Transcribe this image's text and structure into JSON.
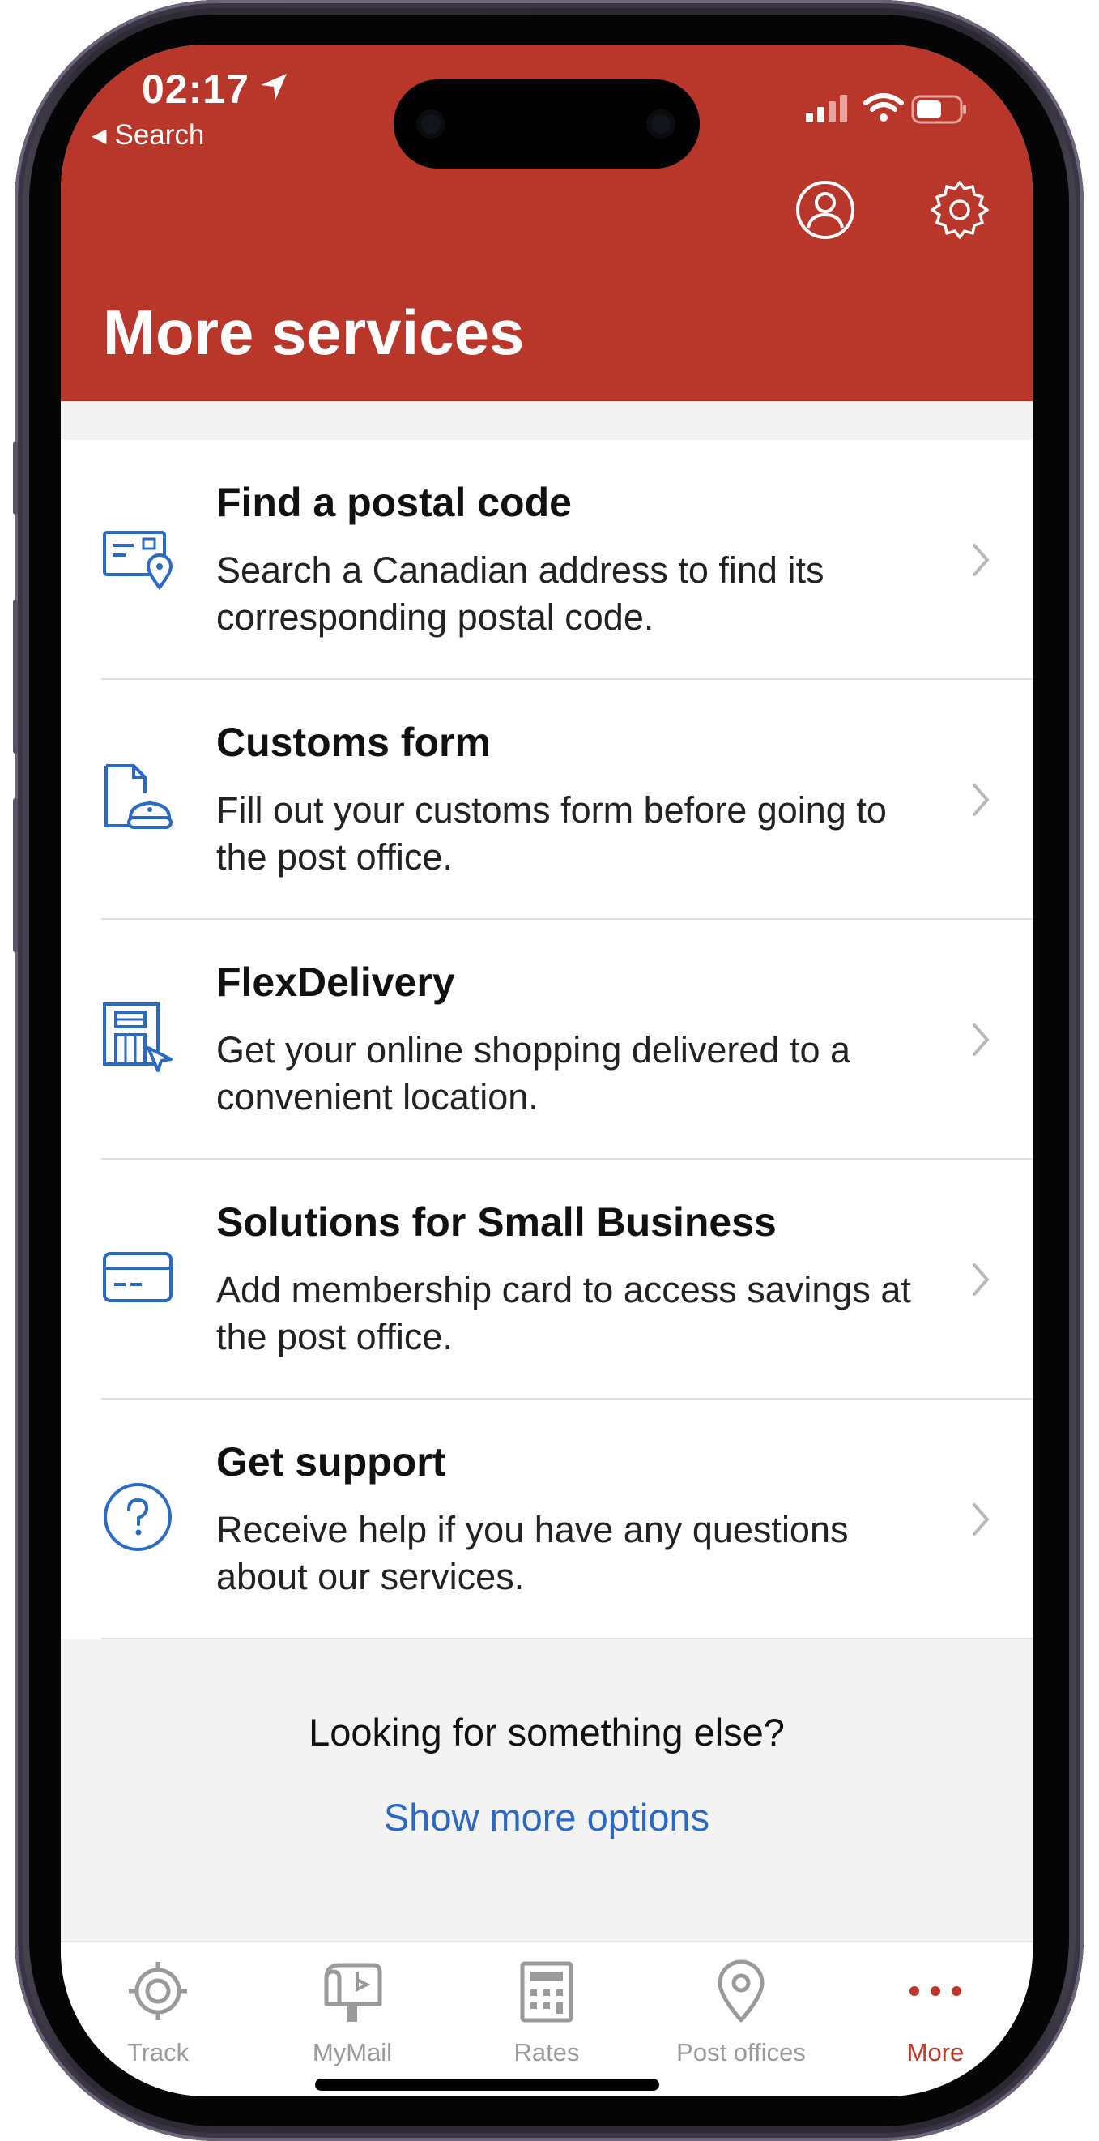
{
  "status_bar": {
    "time": "02:17",
    "back_label": "Search"
  },
  "header": {
    "title": "More services",
    "background_color": "#b8362a",
    "icons": [
      "profile-icon",
      "settings-gear-icon"
    ]
  },
  "services": [
    {
      "title": "Find a postal code",
      "description": "Search a Canadian address to find its corresponding postal code.",
      "icon": "postal-code-map-pin-icon"
    },
    {
      "title": "Customs form",
      "description": "Fill out your customs form before going to the post office.",
      "icon": "customs-form-icon"
    },
    {
      "title": "FlexDelivery",
      "description": "Get your online shopping delivered to a convenient location.",
      "icon": "flexdelivery-building-icon"
    },
    {
      "title": "Solutions for Small Business",
      "description": "Add membership card to access savings at the post office.",
      "icon": "membership-card-icon"
    },
    {
      "title": "Get support",
      "description": "Receive help if you have any questions about our services.",
      "icon": "question-circle-icon"
    }
  ],
  "footer": {
    "prompt": "Looking for something else?",
    "link": "Show more options",
    "link_color": "#2a69c4"
  },
  "tabs": [
    {
      "label": "Track",
      "icon": "track-target-icon",
      "active": false
    },
    {
      "label": "MyMail",
      "icon": "mailbox-icon",
      "active": false
    },
    {
      "label": "Rates",
      "icon": "calculator-icon",
      "active": false
    },
    {
      "label": "Post offices",
      "icon": "location-pin-icon",
      "active": false
    },
    {
      "label": "More",
      "icon": "more-dots-icon",
      "active": true
    }
  ],
  "colors": {
    "accent": "#b8362a",
    "icon_blue": "#2a69c4",
    "inactive_tab": "#9a9a9a"
  }
}
